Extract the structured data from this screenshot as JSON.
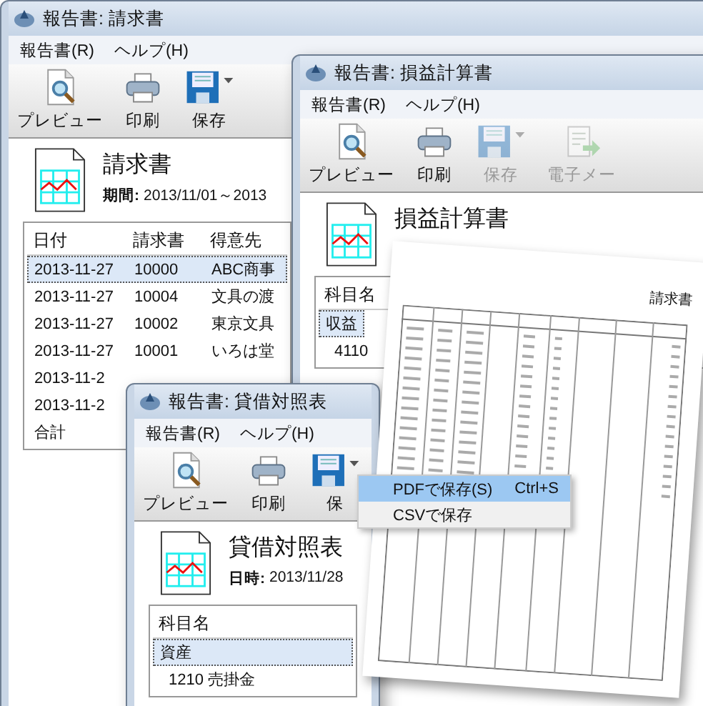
{
  "windows": [
    {
      "title": "報告書: 請求書",
      "menu": [
        "報告書(R)",
        "ヘルプ(H)"
      ],
      "toolbar": [
        {
          "kind": "preview",
          "label": "プレビュー",
          "disabled": false
        },
        {
          "kind": "print",
          "label": "印刷",
          "disabled": false
        },
        {
          "kind": "save",
          "label": "保存",
          "disabled": false
        }
      ],
      "report": {
        "title": "請求書",
        "meta_label": "期間:",
        "meta_value": "2013/11/01～2013"
      },
      "table": {
        "columns": [
          "日付",
          "請求書",
          "得意先"
        ],
        "rows": [
          {
            "cells": [
              "2013-11-27",
              "10000",
              "ABC商事"
            ],
            "selected": true
          },
          {
            "cells": [
              "2013-11-27",
              "10004",
              "文具の渡"
            ],
            "selected": false
          },
          {
            "cells": [
              "2013-11-27",
              "10002",
              "東京文具"
            ],
            "selected": false
          },
          {
            "cells": [
              "2013-11-27",
              "10001",
              "いろは堂"
            ],
            "selected": false
          },
          {
            "cells": [
              "2013-11-2"
            ],
            "selected": false
          },
          {
            "cells": [
              "2013-11-2"
            ],
            "selected": false
          },
          {
            "cells": [
              "合計"
            ],
            "selected": false
          }
        ]
      }
    },
    {
      "title": "報告書: 損益計算書",
      "menu": [
        "報告書(R)",
        "ヘルプ(H)"
      ],
      "toolbar": [
        {
          "kind": "preview",
          "label": "プレビュー",
          "disabled": false
        },
        {
          "kind": "print",
          "label": "印刷",
          "disabled": false
        },
        {
          "kind": "save",
          "label": "保存",
          "disabled": true
        },
        {
          "kind": "email",
          "label": "電子メー",
          "disabled": true
        }
      ],
      "report": {
        "title": "損益計算書"
      },
      "table": {
        "columns": [
          "科目名"
        ],
        "rows": [
          {
            "cells": [
              "収益"
            ],
            "selected": true,
            "children": [
              {
                "cells": [
                  "4110"
                ],
                "selected": false
              }
            ]
          }
        ]
      }
    },
    {
      "title": "報告書: 貸借対照表",
      "menu": [
        "報告書(R)",
        "ヘルプ(H)"
      ],
      "toolbar": [
        {
          "kind": "preview",
          "label": "プレビュー",
          "disabled": false
        },
        {
          "kind": "print",
          "label": "印刷",
          "disabled": false
        },
        {
          "kind": "save",
          "label": "保",
          "disabled": false
        }
      ],
      "report": {
        "title": "貸借対照表",
        "meta_label": "日時:",
        "meta_value": "2013/11/28"
      },
      "table": {
        "columns": [
          "科目名"
        ],
        "rows": [
          {
            "cells": [
              "資産"
            ],
            "selected": true,
            "children": [
              {
                "cells": [
                  "1210 売掛金"
                ],
                "selected": false
              }
            ]
          }
        ]
      }
    }
  ],
  "document": {
    "title": "請求書"
  },
  "context_menu": [
    {
      "label": "PDFで保存(S)",
      "shortcut": "Ctrl+S",
      "selected": true
    },
    {
      "label": "CSVで保存",
      "selected": false
    }
  ]
}
